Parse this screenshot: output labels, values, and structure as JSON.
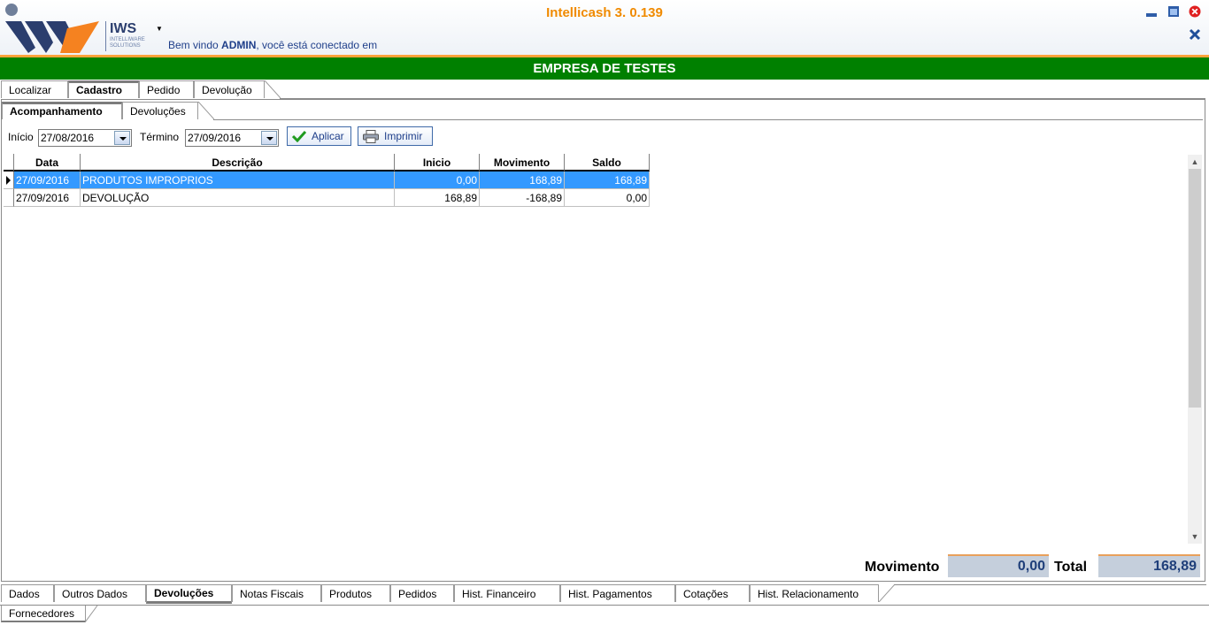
{
  "app": {
    "title": "Intellicash 3. 0.139",
    "logo_text": "IWS",
    "logo_sub": "INTELLIWARE SOLUTIONS",
    "welcome_prefix": "Bem vindo ",
    "welcome_user": "ADMIN",
    "welcome_suffix": ", você está conectado em"
  },
  "company": "EMPRESA DE TESTES",
  "main_tabs": [
    {
      "label": "Localizar",
      "active": false
    },
    {
      "label": "Cadastro",
      "active": true
    },
    {
      "label": "Pedido",
      "active": false
    },
    {
      "label": "Devolução",
      "active": false
    }
  ],
  "sub_tabs": [
    {
      "label": "Acompanhamento",
      "active": true
    },
    {
      "label": "Devoluções",
      "active": false
    }
  ],
  "filters": {
    "inicio_label": "Início",
    "inicio_value": "27/08/2016",
    "termino_label": "Término",
    "termino_value": "27/09/2016",
    "apply_label": "Aplicar",
    "print_label": "Imprimir"
  },
  "grid": {
    "columns": [
      "Data",
      "Descrição",
      "Inicio",
      "Movimento",
      "Saldo"
    ],
    "rows": [
      {
        "data": "27/09/2016",
        "descricao": "PRODUTOS IMPROPRIOS",
        "inicio": "0,00",
        "movimento": "168,89",
        "saldo": "168,89",
        "selected": true
      },
      {
        "data": "27/09/2016",
        "descricao": "DEVOLUÇÃO",
        "inicio": "168,89",
        "movimento": "-168,89",
        "saldo": "0,00",
        "selected": false
      }
    ]
  },
  "totals": {
    "movimento_label": "Movimento",
    "movimento_value": "0,00",
    "total_label": "Total",
    "total_value": "168,89"
  },
  "bottom_tabs": [
    {
      "label": "Dados",
      "active": false
    },
    {
      "label": "Outros Dados",
      "active": false
    },
    {
      "label": "Devoluções",
      "active": true
    },
    {
      "label": "Notas Fiscais",
      "active": false
    },
    {
      "label": "Produtos",
      "active": false
    },
    {
      "label": "Pedidos",
      "active": false
    },
    {
      "label": "Hist. Financeiro",
      "active": false
    },
    {
      "label": "Hist. Pagamentos",
      "active": false
    },
    {
      "label": "Cotações",
      "active": false
    },
    {
      "label": "Hist. Relacionamento",
      "active": false
    }
  ],
  "footer_tabs": [
    {
      "label": "Fornecedores",
      "active": true
    }
  ],
  "colors": {
    "accent_orange": "#f08a00",
    "company_green": "#008000",
    "selection_blue": "#3399ff",
    "link_blue": "#1f3f8a"
  },
  "icons": [
    "iws-logo-icon",
    "chevron-down-icon",
    "minimize-icon",
    "maximize-icon",
    "close-circle-icon",
    "close-x-icon",
    "check-icon",
    "printer-icon",
    "row-indicator-icon",
    "scroll-up-icon",
    "scroll-down-icon"
  ]
}
